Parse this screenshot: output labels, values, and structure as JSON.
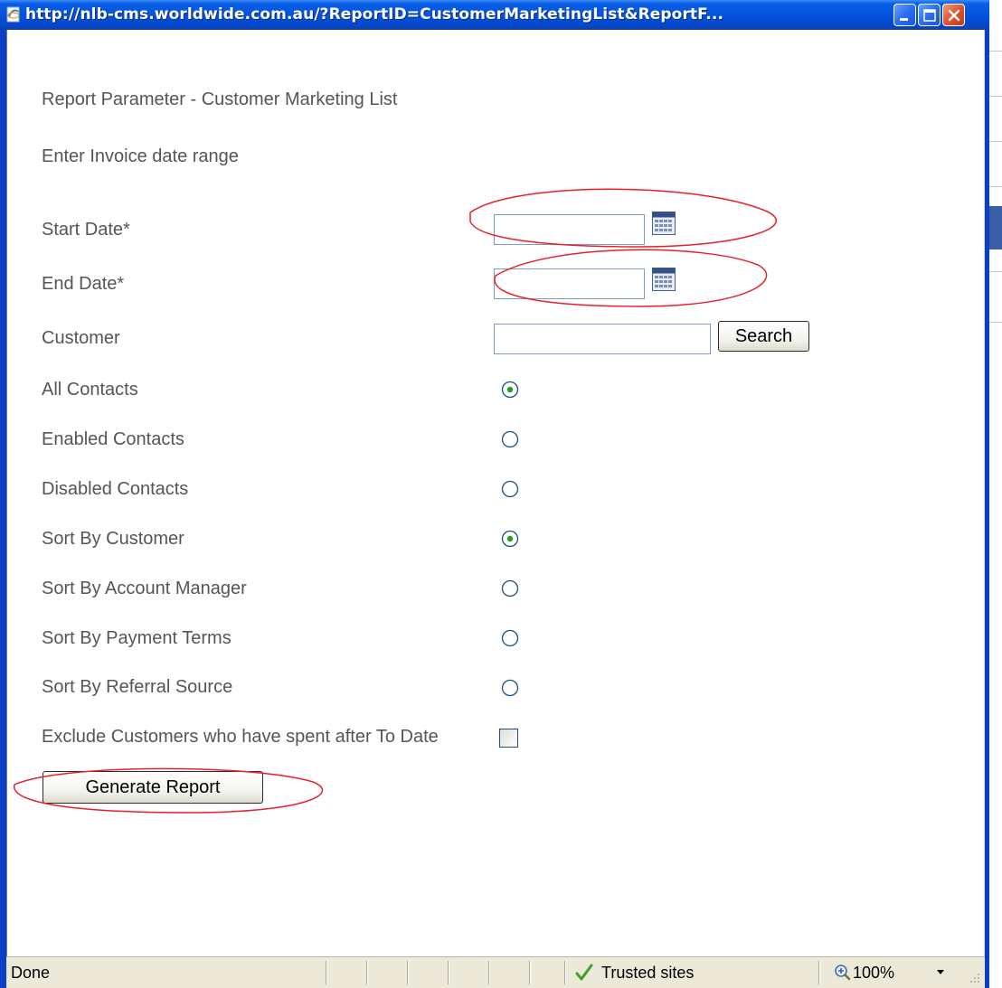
{
  "window": {
    "title": "http://nlb-cms.worldwide.com.au/?ReportID=CustomerMarketingList&ReportF..."
  },
  "page": {
    "heading": "Report Parameter - Customer Marketing List",
    "instruction": "Enter Invoice date range"
  },
  "form": {
    "start_date": {
      "label": "Start Date*",
      "value": ""
    },
    "end_date": {
      "label": "End Date*",
      "value": ""
    },
    "customer": {
      "label": "Customer",
      "value": "",
      "search_label": "Search"
    },
    "contact_filter": {
      "options": [
        {
          "label": "All Contacts",
          "selected": true
        },
        {
          "label": "Enabled Contacts",
          "selected": false
        },
        {
          "label": "Disabled Contacts",
          "selected": false
        }
      ]
    },
    "sort": {
      "options": [
        {
          "label": "Sort By Customer",
          "selected": true
        },
        {
          "label": "Sort By Account Manager",
          "selected": false
        },
        {
          "label": "Sort By Payment Terms",
          "selected": false
        },
        {
          "label": "Sort By Referral Source",
          "selected": false
        }
      ]
    },
    "exclude": {
      "label": "Exclude Customers who have spent after To Date",
      "checked": false
    },
    "generate_label": "Generate Report"
  },
  "annotations": {
    "color": "#e8202a"
  },
  "statusbar": {
    "status": "Done",
    "zone": "Trusted sites",
    "zoom": "100%"
  },
  "icons": {
    "title": "ie-page-icon",
    "calendar": "calendar-icon",
    "zone": "checkmark-icon",
    "zoom": "zoom-icon"
  }
}
